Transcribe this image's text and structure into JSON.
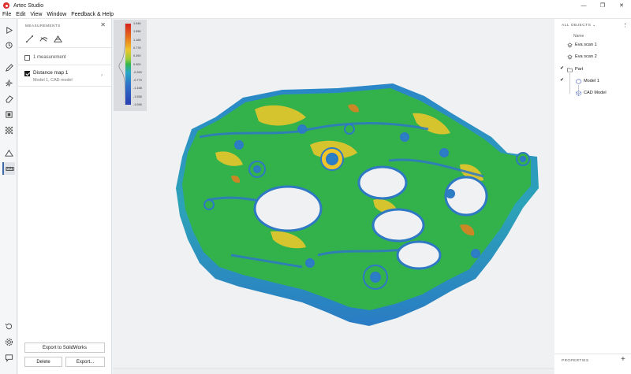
{
  "window": {
    "title": "Artec Studio",
    "controls": {
      "minimize": "—",
      "maximize": "❐",
      "close": "✕"
    }
  },
  "menu": [
    "File",
    "Edit",
    "View",
    "Window",
    "Feedback & Help"
  ],
  "toolbar": {
    "icons": [
      "play-icon",
      "workflow-icon",
      "pen-icon",
      "auto-icon",
      "eraser-icon",
      "texture-icon",
      "grid-icon",
      "triangle-icon",
      "measurements-icon",
      "history-icon",
      "settings-icon",
      "chat-icon"
    ],
    "active": "measurements-icon"
  },
  "measurements": {
    "title": "MEASUREMENTS",
    "close": "✕",
    "tools": [
      "line-distance-icon",
      "surface-distance-icon",
      "distance-map-icon"
    ],
    "count_label": "1 measurement",
    "items": [
      {
        "title": "Distance map 1",
        "subtitle": "Model 1, CAD model",
        "checked": true
      }
    ],
    "buttons": {
      "export_solidworks": "Export to SolidWorks",
      "delete": "Delete",
      "export": "Export..."
    }
  },
  "color_scale": {
    "ticks": [
      "1.946",
      "1.556",
      "1.168",
      "0.778",
      "0.390",
      "0.000",
      "-0.390",
      "-0.779",
      "-1.168",
      "-1.556",
      "-1.946"
    ]
  },
  "objects": {
    "title": "ALL OBJECTS",
    "title_chevron": "⌄",
    "menu": "⋮",
    "column_name": "Name",
    "rows": [
      {
        "label": "Eva scan 1",
        "checked": false,
        "icon": "scan-icon"
      },
      {
        "label": "Eva scan 2",
        "checked": false,
        "icon": "scan-icon"
      },
      {
        "label": "Part",
        "checked": true,
        "icon": "folder-icon"
      },
      {
        "label": "Model 1",
        "checked": true,
        "icon": "model-icon"
      },
      {
        "label": "CAD Model",
        "checked": false,
        "icon": "cad-icon"
      }
    ],
    "check_mark": "✔",
    "properties": "PROPERTIES",
    "add": "+"
  },
  "colors": {
    "accent": "#3d6aa8",
    "mesh_green": "#32b54c",
    "mesh_blue": "#2f78c4",
    "mesh_yellow": "#e8c62c"
  }
}
